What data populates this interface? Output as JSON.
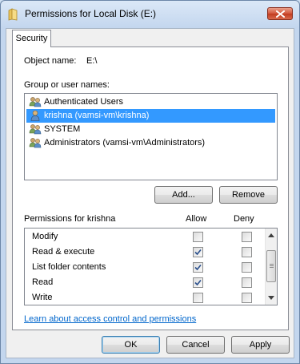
{
  "window": {
    "title": "Permissions for Local Disk (E:)",
    "icon": "folder-icon"
  },
  "tabs": [
    {
      "label": "Security",
      "active": true
    }
  ],
  "object": {
    "label": "Object name:",
    "value": "E:\\"
  },
  "groups": {
    "label": "Group or user names:",
    "items": [
      {
        "name": "Authenticated Users",
        "icon": "group-icon",
        "selected": false
      },
      {
        "name": "krishna (vamsi-vm\\krishna)",
        "icon": "user-icon",
        "selected": true
      },
      {
        "name": "SYSTEM",
        "icon": "group-icon",
        "selected": false
      },
      {
        "name": "Administrators (vamsi-vm\\Administrators)",
        "icon": "group-icon",
        "selected": false
      }
    ],
    "add_label": "Add...",
    "remove_label": "Remove"
  },
  "permissions": {
    "label": "Permissions for krishna",
    "allow_label": "Allow",
    "deny_label": "Deny",
    "rows": [
      {
        "name": "Modify",
        "allow": false,
        "deny": false
      },
      {
        "name": "Read & execute",
        "allow": true,
        "deny": false
      },
      {
        "name": "List folder contents",
        "allow": true,
        "deny": false
      },
      {
        "name": "Read",
        "allow": true,
        "deny": false
      },
      {
        "name": "Write",
        "allow": false,
        "deny": false
      }
    ]
  },
  "link_text": "Learn about access control and permissions",
  "footer": {
    "ok_label": "OK",
    "cancel_label": "Cancel",
    "apply_label": "Apply"
  },
  "colors": {
    "selection": "#3399ff",
    "link": "#0066cc",
    "close": "#c13b1f"
  }
}
